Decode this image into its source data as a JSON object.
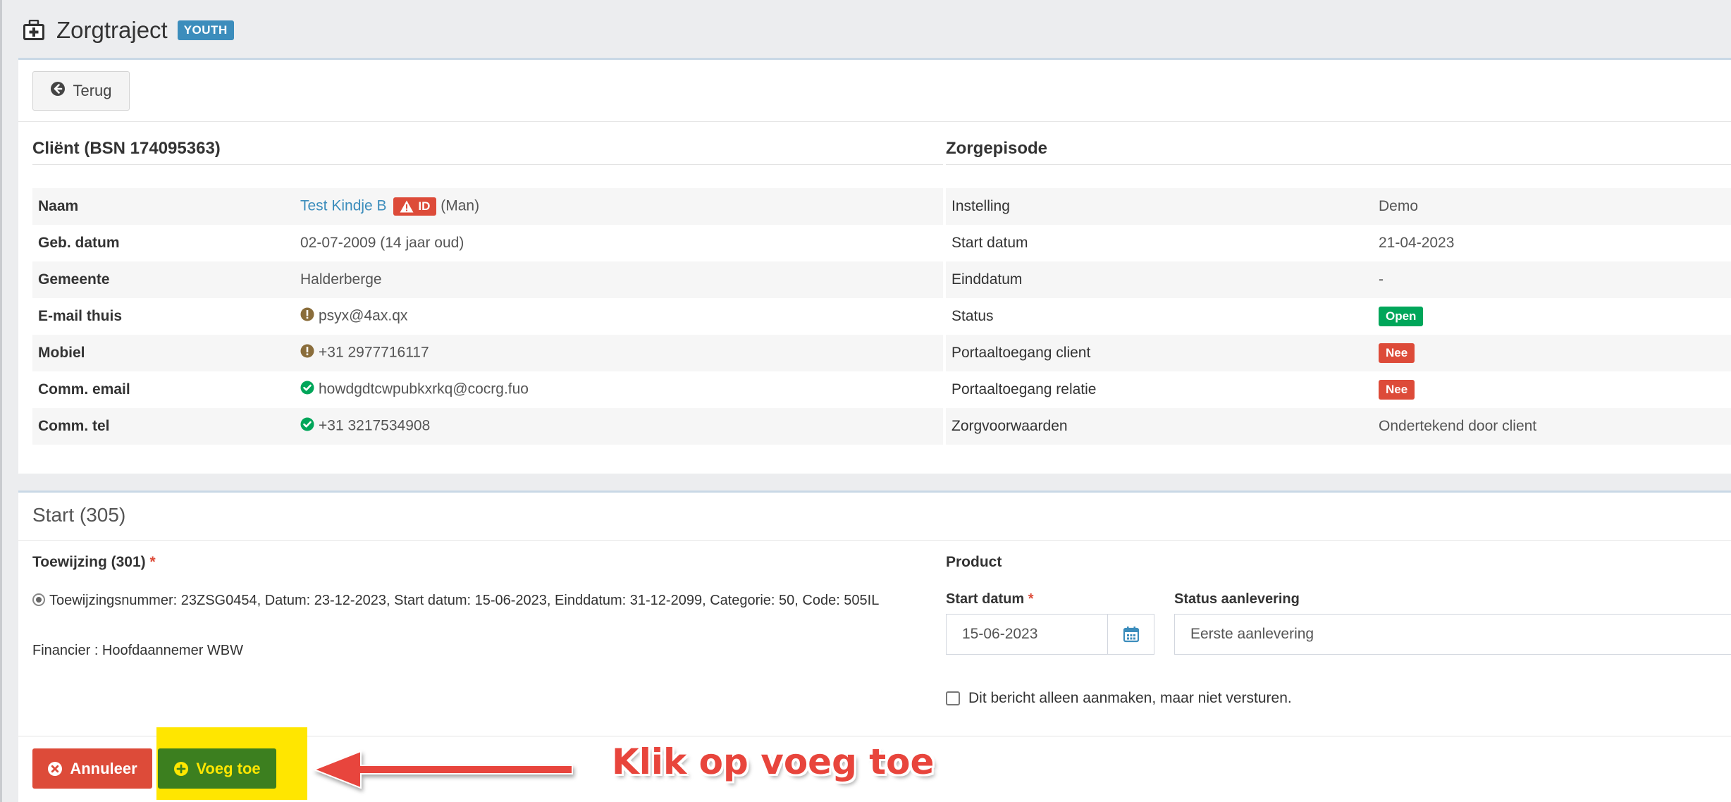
{
  "header": {
    "title": "Zorgtraject",
    "badge": "YOUTH",
    "icon": "medkit-icon"
  },
  "toolbar": {
    "back_label": "Terug"
  },
  "client": {
    "title": "Cliënt (BSN 174095363)",
    "rows": [
      {
        "label": "Naam",
        "value": "Test Kindje B",
        "badge": "ID",
        "suffix": "(Man)"
      },
      {
        "label": "Geb. datum",
        "value": "02-07-2009 (14 jaar oud)"
      },
      {
        "label": "Gemeente",
        "value": "Halderberge"
      },
      {
        "label": "E-mail thuis",
        "value": "psyx@4ax.qx",
        "icon": "exclamation-circle-icon"
      },
      {
        "label": "Mobiel",
        "value": "+31 2977716117",
        "icon": "exclamation-circle-icon"
      },
      {
        "label": "Comm. email",
        "value": "howdgdtcwpubkxrkq@cocrg.fuo",
        "icon": "check-circle-icon"
      },
      {
        "label": "Comm. tel",
        "value": "+31 3217534908",
        "icon": "check-circle-icon"
      }
    ]
  },
  "episode": {
    "title": "Zorgepisode",
    "rows": [
      {
        "label": "Instelling",
        "value": "Demo"
      },
      {
        "label": "Start datum",
        "value": "21-04-2023"
      },
      {
        "label": "Einddatum",
        "value": "-"
      },
      {
        "label": "Status",
        "value": "Open",
        "status_color": "#00a65a"
      },
      {
        "label": "Portaaltoegang client",
        "value": "Nee",
        "status_color": "#dd4b39"
      },
      {
        "label": "Portaaltoegang relatie",
        "value": "Nee",
        "status_color": "#dd4b39"
      },
      {
        "label": "Zorgvoorwaarden",
        "value": "Ondertekend door client"
      }
    ]
  },
  "start": {
    "title": "Start (305)",
    "toewijzing_label": "Toewijzing (301)",
    "toewijzing_option": "Toewijzingsnummer: 23ZSG0454, Datum: 23-12-2023, Start datum: 15-06-2023, Einddatum: 31-12-2099, Categorie: 50, Code: 505IL",
    "financier": "Financier : Hoofdaannemer WBW",
    "product_label": "Product",
    "start_date_label": "Start datum",
    "start_date_value": "15-06-2023",
    "status_label": "Status aanlevering",
    "status_value": "Eerste aanlevering",
    "checkbox_label": "Dit bericht alleen aanmaken, maar niet versturen.",
    "cancel_label": "Annuleer",
    "add_label": "Voeg toe"
  },
  "annotation": {
    "text": "Klik op voeg toe",
    "color": "#e8453c",
    "highlight_color": "#ffe600"
  }
}
